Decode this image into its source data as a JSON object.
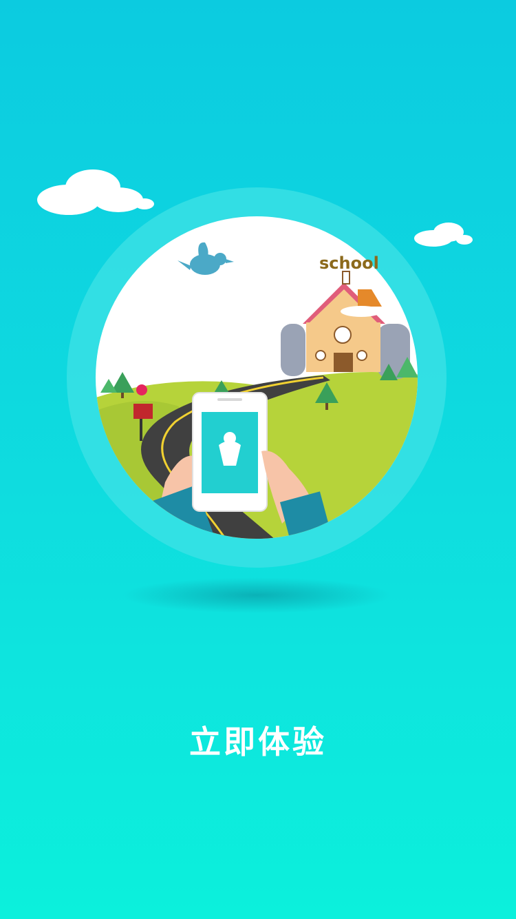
{
  "illustration": {
    "sign_text": "school"
  },
  "cta": {
    "label": "立即体验"
  },
  "colors": {
    "background_top": "#0ccbe0",
    "background_bottom": "#0cf0dc",
    "ring": "#3fe2e6",
    "grass": "#b6d33a",
    "road": "#404040",
    "phone_screen": "#22cfd0"
  },
  "icons": [
    "cloud-icon",
    "bird-icon",
    "tree-icon",
    "mailbox-icon",
    "school-house-icon",
    "phone-icon",
    "child-logo-icon"
  ]
}
